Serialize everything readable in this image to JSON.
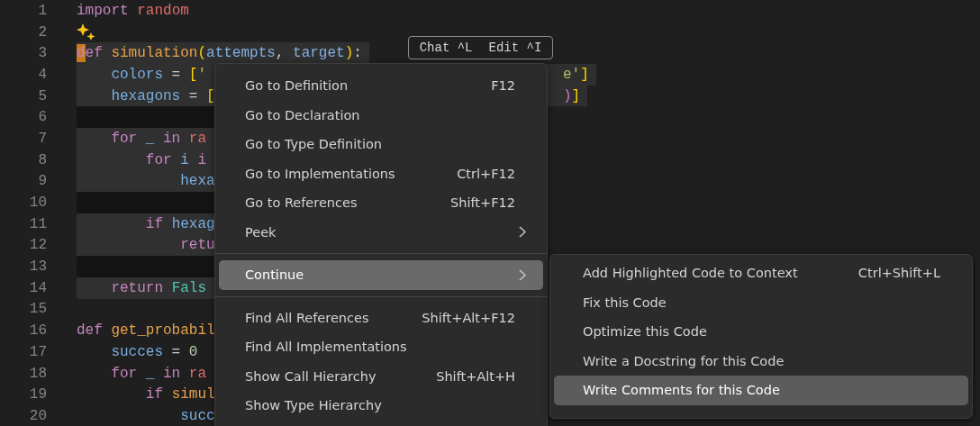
{
  "editor": {
    "lines": [
      {
        "number": "1",
        "kind": "code",
        "tokens": [
          {
            "kind": "kw",
            "text": "import "
          },
          {
            "kind": "mod",
            "text": "random"
          }
        ]
      },
      {
        "number": "2",
        "kind": "sparkle"
      },
      {
        "number": "3",
        "kind": "code",
        "selected": true,
        "cursor": true,
        "tokens": [
          {
            "kind": "kw",
            "text": "def "
          },
          {
            "kind": "fn",
            "text": "simulation"
          },
          {
            "kind": "brk",
            "text": "("
          },
          {
            "kind": "param",
            "text": "attempts"
          },
          {
            "kind": "punc",
            "text": ", "
          },
          {
            "kind": "param",
            "text": "target"
          },
          {
            "kind": "brk",
            "text": ")"
          },
          {
            "kind": "punc",
            "text": ":"
          }
        ]
      },
      {
        "number": "4",
        "kind": "code",
        "selected": true,
        "tokens": [
          {
            "kind": "var",
            "text": "    colors"
          },
          {
            "kind": "punc",
            "text": " = "
          },
          {
            "kind": "brk",
            "text": "["
          },
          {
            "kind": "str",
            "text": "'"
          }
        ],
        "tail": [
          {
            "kind": "str",
            "text": "e'"
          },
          {
            "kind": "brk",
            "text": "]"
          }
        ]
      },
      {
        "number": "5",
        "kind": "code",
        "selected": true,
        "tokens": [
          {
            "kind": "var",
            "text": "    hexagons"
          },
          {
            "kind": "punc",
            "text": " = "
          },
          {
            "kind": "brk",
            "text": "["
          }
        ],
        "tail": [
          {
            "kind": "brk2",
            "text": ")"
          },
          {
            "kind": "brk",
            "text": "]"
          }
        ]
      },
      {
        "number": "6",
        "kind": "code",
        "selected": true
      },
      {
        "number": "7",
        "kind": "code",
        "selected": true,
        "tokens": [
          {
            "kind": "kw",
            "text": "    for "
          },
          {
            "kind": "var",
            "text": "_ "
          },
          {
            "kind": "kw",
            "text": "in "
          },
          {
            "kind": "mod",
            "text": "ra"
          }
        ]
      },
      {
        "number": "8",
        "kind": "code",
        "selected": true,
        "tokens": [
          {
            "kind": "kw",
            "text": "        for "
          },
          {
            "kind": "var",
            "text": "i "
          },
          {
            "kind": "kw",
            "text": "i"
          }
        ]
      },
      {
        "number": "9",
        "kind": "code",
        "selected": true,
        "tokens": [
          {
            "kind": "var",
            "text": "            hexa"
          }
        ]
      },
      {
        "number": "10",
        "kind": "code",
        "selected": true
      },
      {
        "number": "11",
        "kind": "code",
        "selected": true,
        "tokens": [
          {
            "kind": "kw",
            "text": "        if "
          },
          {
            "kind": "var",
            "text": "hexag"
          }
        ]
      },
      {
        "number": "12",
        "kind": "code",
        "selected": true,
        "tokens": [
          {
            "kind": "kw",
            "text": "            retu"
          }
        ]
      },
      {
        "number": "13",
        "kind": "code",
        "selected": true
      },
      {
        "number": "14",
        "kind": "code",
        "selected": true,
        "tokens": [
          {
            "kind": "kw",
            "text": "    return "
          },
          {
            "kind": "const",
            "text": "Fals"
          }
        ]
      },
      {
        "number": "15",
        "kind": "code"
      },
      {
        "number": "16",
        "kind": "code",
        "tokens": [
          {
            "kind": "kw",
            "text": "def "
          },
          {
            "kind": "fn",
            "text": "get_probabil"
          }
        ]
      },
      {
        "number": "17",
        "kind": "code",
        "tokens": [
          {
            "kind": "var",
            "text": "    succes"
          },
          {
            "kind": "punc",
            "text": " = "
          },
          {
            "kind": "num",
            "text": "0"
          }
        ]
      },
      {
        "number": "18",
        "kind": "code",
        "tokens": [
          {
            "kind": "kw",
            "text": "    for "
          },
          {
            "kind": "var",
            "text": "_ "
          },
          {
            "kind": "kw",
            "text": "in "
          },
          {
            "kind": "mod",
            "text": "ra"
          }
        ]
      },
      {
        "number": "19",
        "kind": "code",
        "tokens": [
          {
            "kind": "kw",
            "text": "        if "
          },
          {
            "kind": "fn",
            "text": "simul"
          }
        ]
      },
      {
        "number": "20",
        "kind": "code",
        "tokens": [
          {
            "kind": "var",
            "text": "            succ"
          }
        ]
      }
    ]
  },
  "inline_hint": {
    "chat": "Chat ^L",
    "edit": "Edit ^I"
  },
  "context_menu": {
    "groups": [
      [
        {
          "label": "Go to Definition",
          "shortcut": "F12",
          "submenu": false,
          "selected": false
        },
        {
          "label": "Go to Declaration",
          "submenu": false,
          "selected": false
        },
        {
          "label": "Go to Type Definition",
          "submenu": false,
          "selected": false
        },
        {
          "label": "Go to Implementations",
          "shortcut": "Ctrl+F12",
          "submenu": false,
          "selected": false
        },
        {
          "label": "Go to References",
          "shortcut": "Shift+F12",
          "submenu": false,
          "selected": false
        },
        {
          "label": "Peek",
          "submenu": true,
          "selected": false
        }
      ],
      [
        {
          "label": "Continue",
          "submenu": true,
          "selected": true
        }
      ],
      [
        {
          "label": "Find All References",
          "shortcut": "Shift+Alt+F12",
          "submenu": false,
          "selected": false
        },
        {
          "label": "Find All Implementations",
          "submenu": false,
          "selected": false
        },
        {
          "label": "Show Call Hierarchy",
          "shortcut": "Shift+Alt+H",
          "submenu": false,
          "selected": false
        },
        {
          "label": "Show Type Hierarchy",
          "submenu": false,
          "selected": false
        }
      ]
    ]
  },
  "submenu": {
    "items": [
      {
        "label": "Add Highlighted Code to Context",
        "shortcut": "Ctrl+Shift+L",
        "selected": false
      },
      {
        "label": "Fix this Code",
        "selected": false
      },
      {
        "label": "Optimize this Code",
        "selected": false
      },
      {
        "label": "Write a Docstring for this Code",
        "selected": false
      },
      {
        "label": "Write Comments for this Code",
        "selected": true
      }
    ]
  }
}
